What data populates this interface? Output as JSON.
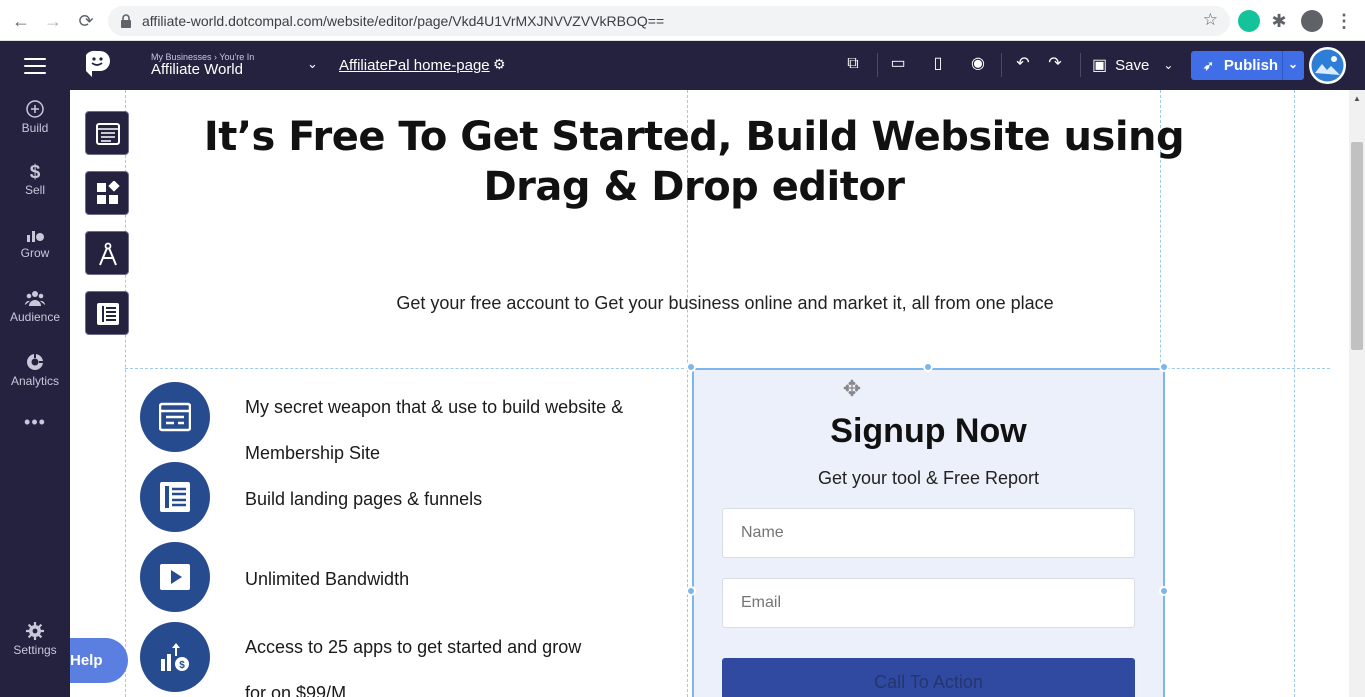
{
  "browser": {
    "url": "affiliate-world.dotcompal.com/website/editor/page/Vkd4U1VrMXJNVVZVVkRBOQ=="
  },
  "header": {
    "business_crumb": "My Businesses › You're In",
    "business_name": "Affiliate World",
    "page_name": "AffiliatePal home-page",
    "save_label": "Save",
    "publish_label": "Publish"
  },
  "sidebar": {
    "items": [
      {
        "label": "Build",
        "icon": "plus-circle-icon"
      },
      {
        "label": "Sell",
        "icon": "dollar-icon"
      },
      {
        "label": "Grow",
        "icon": "grow-chart-icon"
      },
      {
        "label": "Audience",
        "icon": "audience-icon"
      },
      {
        "label": "Analytics",
        "icon": "analytics-icon"
      },
      {
        "label": "Settings",
        "icon": "gear-icon"
      }
    ]
  },
  "canvas": {
    "title": "It’s Free To Get Started, Build Website using Drag & Drop editor",
    "subtitle": "Get your free account to Get your business online and market it, all from one place",
    "features": [
      {
        "line1": "My secret weapon that & use to build website &",
        "line2": "Membership Site"
      },
      {
        "line1": "Build landing pages & funnels"
      },
      {
        "line1": "Unlimited Bandwidth"
      },
      {
        "line1": "Access to 25 apps to get started and grow",
        "line2": "for on $99/M"
      }
    ],
    "signup": {
      "title": "Signup Now",
      "subtitle": "Get your tool & Free Report",
      "name_placeholder": "Name",
      "email_placeholder": "Email",
      "cta_label": "Call To Action"
    },
    "help_label": "Help"
  },
  "colors": {
    "app_bar": "#25223f",
    "publish": "#3f6ee7",
    "feature_circle": "#264b8e",
    "signup_bg": "#ecf0fb"
  }
}
